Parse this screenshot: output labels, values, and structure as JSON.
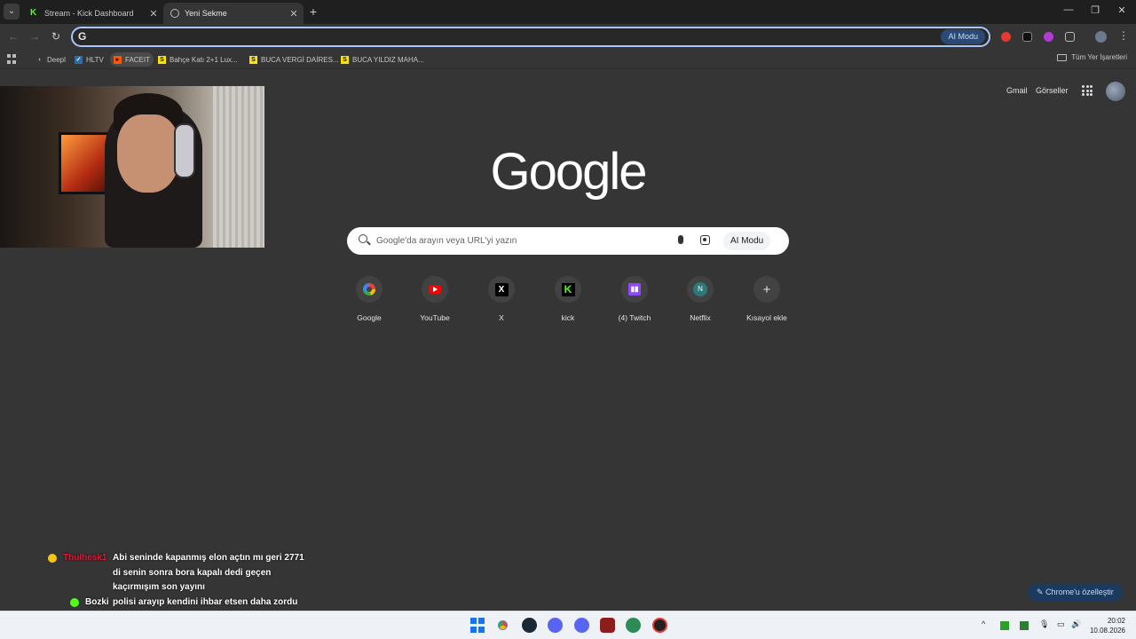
{
  "browser": {
    "tabs": [
      {
        "title": "Stream - Kick Dashboard",
        "favicon": "kick-icon",
        "active": false
      },
      {
        "title": "Yeni Sekme",
        "favicon": "globe-icon",
        "active": true
      }
    ],
    "omnibox": {
      "value": "",
      "ai_mode_label": "AI Modu"
    },
    "bookmarks": [
      {
        "label": "Deepl",
        "icon": "deepl-icon"
      },
      {
        "label": "HLTV",
        "icon": "hltv-icon"
      },
      {
        "label": "FACEIT",
        "icon": "faceit-icon"
      },
      {
        "label": "Bahçe Katı 2+1 Lux...",
        "icon": "sahibinden-icon"
      },
      {
        "label": "BUCA VERGİ DAİRES...",
        "icon": "sahibinden-icon"
      },
      {
        "label": "BUCA YILDIZ MAHA...",
        "icon": "sahibinden-icon"
      }
    ],
    "all_bookmarks_label": "Tüm Yer İşaretleri"
  },
  "newtab": {
    "top_links": {
      "gmail": "Gmail",
      "images": "Görseller"
    },
    "logo_text": "Google",
    "search": {
      "placeholder": "Google'da arayın veya URL'yi yazın",
      "ai_mode_label": "AI Modu"
    },
    "shortcuts": [
      {
        "label": "Google",
        "icon": "google-icon"
      },
      {
        "label": "YouTube",
        "icon": "youtube-icon"
      },
      {
        "label": "X",
        "icon": "x-icon",
        "glyph": "X"
      },
      {
        "label": "kick",
        "icon": "kick-icon",
        "glyph": "K"
      },
      {
        "label": "(4) Twitch",
        "icon": "twitch-icon",
        "glyph": "▮▮"
      },
      {
        "label": "Netflix",
        "icon": "netflix-icon",
        "glyph": "N"
      },
      {
        "label": "Kısayol ekle",
        "icon": "plus-icon",
        "glyph": "+"
      }
    ],
    "customize_label": "Chrome'u özelleştir"
  },
  "chat": [
    {
      "user": "Thulhesk1",
      "message_lines": [
        "Abi seninde kapanmış elon açtın mı geri 2771",
        "di senin sonra bora kapalı dedi geçen",
        "kaçırmışım son yayını"
      ],
      "badge_color": "#f5c518"
    },
    {
      "user": "Bozki",
      "message_lines": [
        "polisi arayıp kendini ihbar etsen daha zordu"
      ],
      "badge_color": "#53fc18"
    }
  ],
  "taskbar": {
    "time": "20:02",
    "date": "10.08.2026"
  },
  "colors": {
    "accent": "#a8c7fa",
    "kick_green": "#53fc18",
    "background": "#353535"
  }
}
